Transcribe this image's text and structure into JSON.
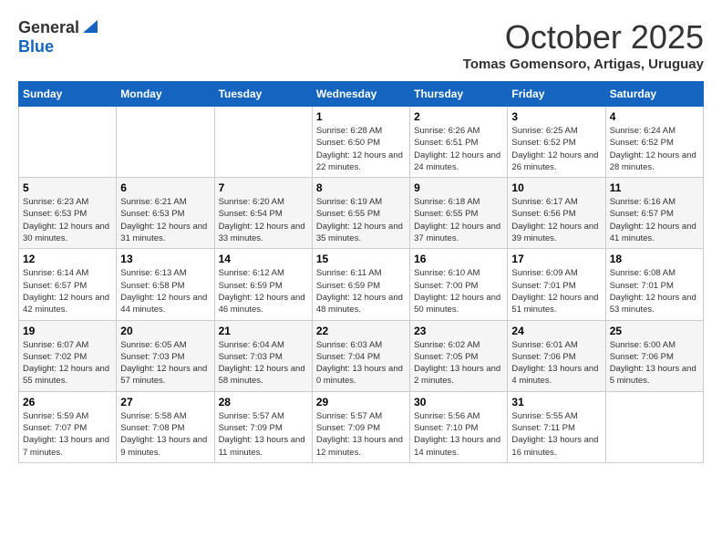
{
  "logo": {
    "general": "General",
    "blue": "Blue"
  },
  "title": "October 2025",
  "location": "Tomas Gomensoro, Artigas, Uruguay",
  "days_of_week": [
    "Sunday",
    "Monday",
    "Tuesday",
    "Wednesday",
    "Thursday",
    "Friday",
    "Saturday"
  ],
  "weeks": [
    [
      {
        "num": "",
        "info": ""
      },
      {
        "num": "",
        "info": ""
      },
      {
        "num": "",
        "info": ""
      },
      {
        "num": "1",
        "info": "Sunrise: 6:28 AM\nSunset: 6:50 PM\nDaylight: 12 hours and 22 minutes."
      },
      {
        "num": "2",
        "info": "Sunrise: 6:26 AM\nSunset: 6:51 PM\nDaylight: 12 hours and 24 minutes."
      },
      {
        "num": "3",
        "info": "Sunrise: 6:25 AM\nSunset: 6:52 PM\nDaylight: 12 hours and 26 minutes."
      },
      {
        "num": "4",
        "info": "Sunrise: 6:24 AM\nSunset: 6:52 PM\nDaylight: 12 hours and 28 minutes."
      }
    ],
    [
      {
        "num": "5",
        "info": "Sunrise: 6:23 AM\nSunset: 6:53 PM\nDaylight: 12 hours and 30 minutes."
      },
      {
        "num": "6",
        "info": "Sunrise: 6:21 AM\nSunset: 6:53 PM\nDaylight: 12 hours and 31 minutes."
      },
      {
        "num": "7",
        "info": "Sunrise: 6:20 AM\nSunset: 6:54 PM\nDaylight: 12 hours and 33 minutes."
      },
      {
        "num": "8",
        "info": "Sunrise: 6:19 AM\nSunset: 6:55 PM\nDaylight: 12 hours and 35 minutes."
      },
      {
        "num": "9",
        "info": "Sunrise: 6:18 AM\nSunset: 6:55 PM\nDaylight: 12 hours and 37 minutes."
      },
      {
        "num": "10",
        "info": "Sunrise: 6:17 AM\nSunset: 6:56 PM\nDaylight: 12 hours and 39 minutes."
      },
      {
        "num": "11",
        "info": "Sunrise: 6:16 AM\nSunset: 6:57 PM\nDaylight: 12 hours and 41 minutes."
      }
    ],
    [
      {
        "num": "12",
        "info": "Sunrise: 6:14 AM\nSunset: 6:57 PM\nDaylight: 12 hours and 42 minutes."
      },
      {
        "num": "13",
        "info": "Sunrise: 6:13 AM\nSunset: 6:58 PM\nDaylight: 12 hours and 44 minutes."
      },
      {
        "num": "14",
        "info": "Sunrise: 6:12 AM\nSunset: 6:59 PM\nDaylight: 12 hours and 46 minutes."
      },
      {
        "num": "15",
        "info": "Sunrise: 6:11 AM\nSunset: 6:59 PM\nDaylight: 12 hours and 48 minutes."
      },
      {
        "num": "16",
        "info": "Sunrise: 6:10 AM\nSunset: 7:00 PM\nDaylight: 12 hours and 50 minutes."
      },
      {
        "num": "17",
        "info": "Sunrise: 6:09 AM\nSunset: 7:01 PM\nDaylight: 12 hours and 51 minutes."
      },
      {
        "num": "18",
        "info": "Sunrise: 6:08 AM\nSunset: 7:01 PM\nDaylight: 12 hours and 53 minutes."
      }
    ],
    [
      {
        "num": "19",
        "info": "Sunrise: 6:07 AM\nSunset: 7:02 PM\nDaylight: 12 hours and 55 minutes."
      },
      {
        "num": "20",
        "info": "Sunrise: 6:05 AM\nSunset: 7:03 PM\nDaylight: 12 hours and 57 minutes."
      },
      {
        "num": "21",
        "info": "Sunrise: 6:04 AM\nSunset: 7:03 PM\nDaylight: 12 hours and 58 minutes."
      },
      {
        "num": "22",
        "info": "Sunrise: 6:03 AM\nSunset: 7:04 PM\nDaylight: 13 hours and 0 minutes."
      },
      {
        "num": "23",
        "info": "Sunrise: 6:02 AM\nSunset: 7:05 PM\nDaylight: 13 hours and 2 minutes."
      },
      {
        "num": "24",
        "info": "Sunrise: 6:01 AM\nSunset: 7:06 PM\nDaylight: 13 hours and 4 minutes."
      },
      {
        "num": "25",
        "info": "Sunrise: 6:00 AM\nSunset: 7:06 PM\nDaylight: 13 hours and 5 minutes."
      }
    ],
    [
      {
        "num": "26",
        "info": "Sunrise: 5:59 AM\nSunset: 7:07 PM\nDaylight: 13 hours and 7 minutes."
      },
      {
        "num": "27",
        "info": "Sunrise: 5:58 AM\nSunset: 7:08 PM\nDaylight: 13 hours and 9 minutes."
      },
      {
        "num": "28",
        "info": "Sunrise: 5:57 AM\nSunset: 7:09 PM\nDaylight: 13 hours and 11 minutes."
      },
      {
        "num": "29",
        "info": "Sunrise: 5:57 AM\nSunset: 7:09 PM\nDaylight: 13 hours and 12 minutes."
      },
      {
        "num": "30",
        "info": "Sunrise: 5:56 AM\nSunset: 7:10 PM\nDaylight: 13 hours and 14 minutes."
      },
      {
        "num": "31",
        "info": "Sunrise: 5:55 AM\nSunset: 7:11 PM\nDaylight: 13 hours and 16 minutes."
      },
      {
        "num": "",
        "info": ""
      }
    ]
  ]
}
